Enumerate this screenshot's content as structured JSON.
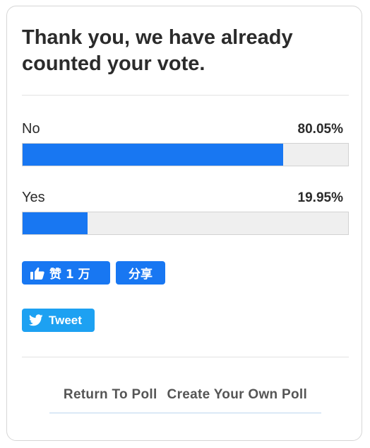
{
  "heading": "Thank you, we have already counted your vote.",
  "results": [
    {
      "label": "No",
      "percent_text": "80.05%",
      "percent": 80.05
    },
    {
      "label": "Yes",
      "percent_text": "19.95%",
      "percent": 19.95
    }
  ],
  "social": {
    "like_label": "赞 1 万",
    "share_label": "分享",
    "tweet_label": "Tweet"
  },
  "footer": {
    "return_label": "Return To Poll",
    "create_label": "Create Your Own Poll"
  },
  "colors": {
    "bar_fill": "#1877f2",
    "bar_track": "#efefef",
    "facebook": "#1877f2",
    "twitter": "#1da1f2"
  },
  "icons": [
    "thumbs-up-icon",
    "twitter-bird-icon"
  ]
}
